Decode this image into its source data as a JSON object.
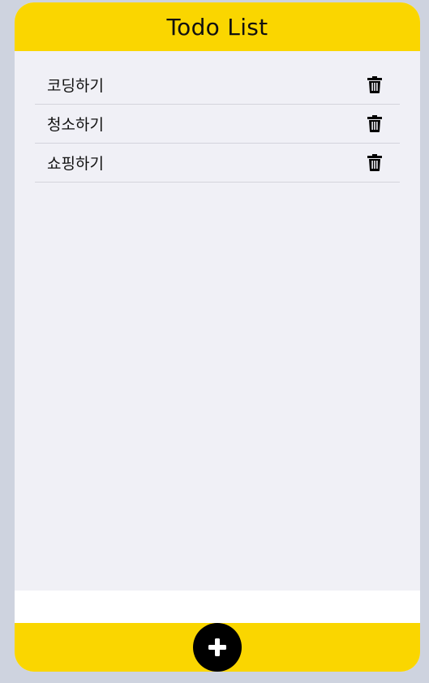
{
  "header": {
    "title": "Todo List"
  },
  "todos": [
    {
      "text": "코딩하기",
      "delete_icon": "trash-icon"
    },
    {
      "text": "청소하기",
      "delete_icon": "trash-icon"
    },
    {
      "text": "쇼핑하기",
      "delete_icon": "trash-icon"
    }
  ],
  "footer": {
    "add_icon": "plus-icon"
  },
  "colors": {
    "accent": "#fad600",
    "list_background": "#f0f0f6",
    "page_background": "#ced3df",
    "button": "#000000"
  }
}
